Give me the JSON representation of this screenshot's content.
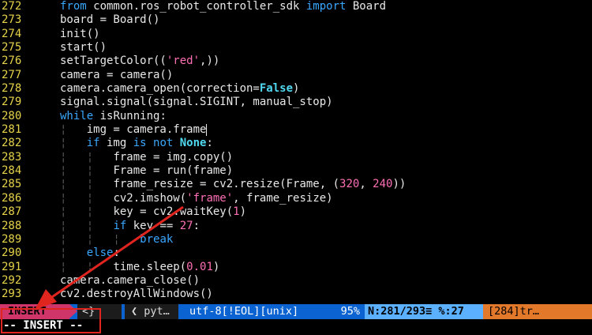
{
  "editor": {
    "lines": [
      {
        "num": "272",
        "tokens": [
          {
            "t": "from",
            "c": "kw"
          },
          {
            "t": " common.ros_robot_controller_sdk "
          },
          {
            "t": "import",
            "c": "kw"
          },
          {
            "t": " Board"
          }
        ]
      },
      {
        "num": "273",
        "tokens": [
          {
            "t": "board = Board()"
          }
        ]
      },
      {
        "num": "274",
        "tokens": [
          {
            "t": "init()"
          }
        ]
      },
      {
        "num": "275",
        "tokens": [
          {
            "t": "start()"
          }
        ]
      },
      {
        "num": "276",
        "tokens": [
          {
            "t": "setTargetColor(("
          },
          {
            "t": "'red'",
            "c": "str"
          },
          {
            "t": ",))"
          }
        ]
      },
      {
        "num": "277",
        "tokens": [
          {
            "t": "camera = camera()"
          }
        ]
      },
      {
        "num": "278",
        "tokens": [
          {
            "t": "camera.camera_open(correction="
          },
          {
            "t": "False",
            "c": "const"
          },
          {
            "t": ")"
          }
        ]
      },
      {
        "num": "279",
        "tokens": [
          {
            "t": "signal.signal(signal.SIGINT, manual_stop)"
          }
        ]
      },
      {
        "num": "280",
        "tokens": [
          {
            "t": "while",
            "c": "kw"
          },
          {
            "t": " isRunning:"
          }
        ]
      },
      {
        "num": "281",
        "tokens": [
          {
            "t": "¦   ",
            "c": "guide"
          },
          {
            "t": "img = camera.frame"
          },
          {
            "cursor": true
          }
        ]
      },
      {
        "num": "282",
        "tokens": [
          {
            "t": "¦   ",
            "c": "guide"
          },
          {
            "t": "if",
            "c": "kw"
          },
          {
            "t": " img "
          },
          {
            "t": "is not",
            "c": "kw"
          },
          {
            "t": " "
          },
          {
            "t": "None",
            "c": "const"
          },
          {
            "t": ":"
          }
        ]
      },
      {
        "num": "283",
        "tokens": [
          {
            "t": "¦   ¦   ",
            "c": "guide"
          },
          {
            "t": "frame = img.copy()"
          }
        ]
      },
      {
        "num": "284",
        "tokens": [
          {
            "t": "¦   ¦   ",
            "c": "guide"
          },
          {
            "t": "Frame = run(frame)"
          }
        ]
      },
      {
        "num": "285",
        "tokens": [
          {
            "t": "¦   ¦   ",
            "c": "guide"
          },
          {
            "t": "frame_resize = cv2.resize(Frame, ("
          },
          {
            "t": "320",
            "c": "num"
          },
          {
            "t": ", "
          },
          {
            "t": "240",
            "c": "num"
          },
          {
            "t": "))"
          }
        ]
      },
      {
        "num": "286",
        "tokens": [
          {
            "t": "¦   ¦   ",
            "c": "guide"
          },
          {
            "t": "cv2.imshow("
          },
          {
            "t": "'frame'",
            "c": "str"
          },
          {
            "t": ", frame_resize)"
          }
        ]
      },
      {
        "num": "287",
        "tokens": [
          {
            "t": "¦   ¦   ",
            "c": "guide"
          },
          {
            "t": "key = cv2.waitKey("
          },
          {
            "t": "1",
            "c": "num"
          },
          {
            "t": ")"
          }
        ]
      },
      {
        "num": "288",
        "tokens": [
          {
            "t": "¦   ¦   ",
            "c": "guide"
          },
          {
            "t": "if",
            "c": "kw"
          },
          {
            "t": " key == "
          },
          {
            "t": "27",
            "c": "num"
          },
          {
            "t": ":"
          }
        ]
      },
      {
        "num": "289",
        "tokens": [
          {
            "t": "¦   ¦   ¦   ",
            "c": "guide"
          },
          {
            "t": "break",
            "c": "kw"
          }
        ]
      },
      {
        "num": "290",
        "tokens": [
          {
            "t": "¦   ",
            "c": "guide"
          },
          {
            "t": "else",
            "c": "kw"
          },
          {
            "t": ":"
          }
        ]
      },
      {
        "num": "291",
        "tokens": [
          {
            "t": "¦   ¦   ",
            "c": "guide"
          },
          {
            "t": "time.sleep("
          },
          {
            "t": "0.01",
            "c": "num"
          },
          {
            "t": ")"
          }
        ]
      },
      {
        "num": "292",
        "tokens": [
          {
            "t": "camera.camera_close()"
          }
        ]
      },
      {
        "num": "293",
        "tokens": [
          {
            "t": "cv2.destroyAllWindows()"
          }
        ]
      }
    ]
  },
  "statusline": {
    "mode": "INSERT",
    "branch_sep": "<}",
    "filetype": "pyt…",
    "encoding": "utf-8[!EOL][unix]",
    "percent": "95%",
    "position": "N:281/293≡ %:27",
    "warning": "[284]tr…"
  },
  "cmdline": {
    "text": "-- INSERT --"
  },
  "colors": {
    "line_number": "#e6d34a",
    "keyword": "#3aa7ff",
    "string": "#ff6fb5",
    "constant": "#50d8f0",
    "statusline_bg": "#0a63d1",
    "mode_bg": "#d0356a",
    "position_bg": "#5bb1ff",
    "warning_bg": "#e2782a",
    "annotation_red": "#e0251f"
  }
}
